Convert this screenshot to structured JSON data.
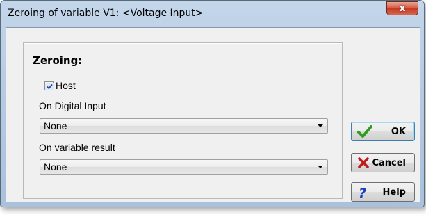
{
  "window": {
    "title": "Zeroing of variable V1: <Voltage Input>",
    "close_label": "x"
  },
  "group": {
    "title": "Zeroing:",
    "host": {
      "label": "Host",
      "checked": true
    },
    "digital_input": {
      "label": "On Digital Input",
      "value": "None"
    },
    "variable_result": {
      "label": "On variable result",
      "value": "None"
    }
  },
  "buttons": {
    "ok": {
      "label": "OK",
      "icon": "checkmark-icon"
    },
    "cancel": {
      "label": "Cancel",
      "icon": "x-icon"
    },
    "help": {
      "label": "Help",
      "icon": "question-icon"
    }
  },
  "colors": {
    "titlebar": "#b7cce3",
    "close_button": "#d7513a",
    "ok_check": "#2e9d22",
    "cancel_x": "#c21a1a",
    "help_q": "#1a3fb8"
  }
}
